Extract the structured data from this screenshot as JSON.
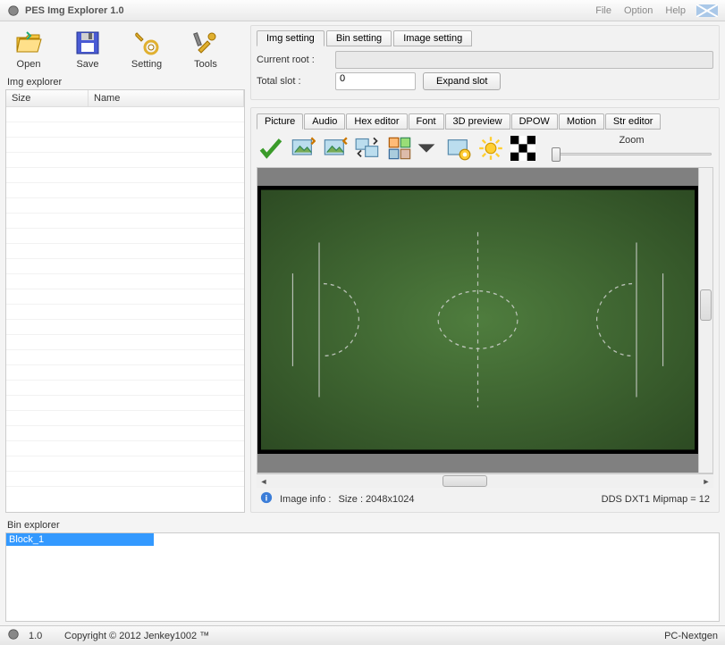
{
  "window": {
    "title": "PES Img Explorer 1.0"
  },
  "menus": {
    "file": "File",
    "option": "Option",
    "help": "Help"
  },
  "toolbar": {
    "open": "Open",
    "save": "Save",
    "setting": "Setting",
    "tools": "Tools"
  },
  "img_explorer_label": "Img explorer",
  "list_headers": {
    "size": "Size",
    "name": "Name"
  },
  "top_tabs": {
    "img": "Img setting",
    "bin": "Bin setting",
    "image": "Image setting"
  },
  "form": {
    "current_root_label": "Current root :",
    "current_root_value": "",
    "total_slot_label": "Total slot :",
    "total_slot_value": "0",
    "expand_slot": "Expand slot"
  },
  "editor_tabs": {
    "picture": "Picture",
    "audio": "Audio",
    "hex": "Hex editor",
    "font": "Font",
    "preview3d": "3D preview",
    "dpow": "DPOW",
    "motion": "Motion",
    "str": "Str editor"
  },
  "zoom_label": "Zoom",
  "image_info": {
    "label": "Image info :",
    "size": "Size : 2048x1024",
    "format": "DDS DXT1 Mipmap = 12"
  },
  "bin_explorer_label": "Bin explorer",
  "bin_items": {
    "block1": "Block_1"
  },
  "status": {
    "version": "1.0",
    "copyright": "Copyright © 2012 Jenkey1002 ™",
    "platform": "PC-Nextgen"
  }
}
